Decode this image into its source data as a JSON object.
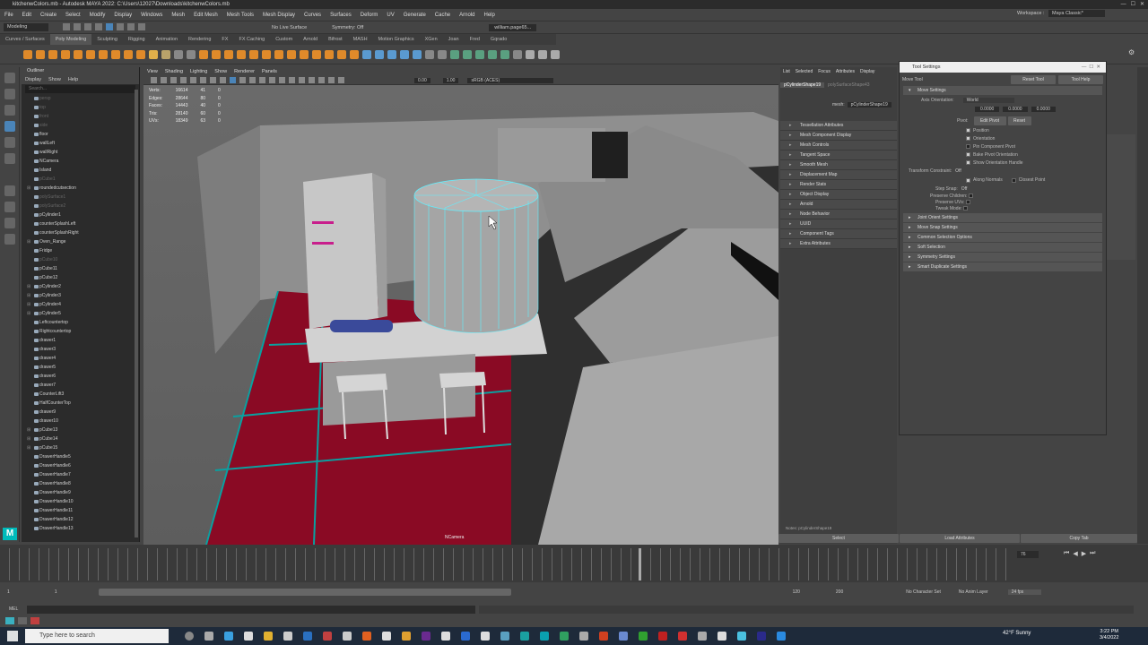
{
  "window": {
    "title": "kitchenwColors.mb - Autodesk MAYA 2022: C:\\Users\\12027\\Downloads\\kitchenwColors.mb"
  },
  "menubar": {
    "items": [
      "File",
      "Edit",
      "Create",
      "Select",
      "Modify",
      "Display",
      "Windows",
      "Mesh",
      "Edit Mesh",
      "Mesh Tools",
      "Mesh Display",
      "Curves",
      "Surfaces",
      "Deform",
      "UV",
      "Generate",
      "Cache",
      "Arnold",
      "Help"
    ],
    "workspace_label": "Workspace :",
    "workspace_value": "Maya Classic*"
  },
  "statusline": {
    "mode": "Modeling",
    "live_surface": "No Live Surface",
    "symmetry": "Symmetry: Off",
    "user": "william.page65..."
  },
  "shelf_tabs": [
    "Curves / Surfaces",
    "Poly Modeling",
    "Sculpting",
    "Rigging",
    "Animation",
    "Rendering",
    "FX",
    "FX Caching",
    "Custom",
    "Arnold",
    "Bifrost",
    "MASH",
    "Motion Graphics",
    "XGen",
    "Joan",
    "Fred",
    "Gqrado"
  ],
  "shelf_active": "Poly Modeling",
  "outliner": {
    "title": "Outliner",
    "menus": [
      "Display",
      "Show",
      "Help"
    ],
    "search_placeholder": "Search...",
    "items": [
      {
        "label": "persp",
        "dim": true
      },
      {
        "label": "top",
        "dim": true
      },
      {
        "label": "front",
        "dim": true
      },
      {
        "label": "side",
        "dim": true
      },
      {
        "label": "floor",
        "dim": false
      },
      {
        "label": "wallLeft",
        "dim": false
      },
      {
        "label": "wallRight",
        "dim": false
      },
      {
        "label": "NCamera",
        "dim": false
      },
      {
        "label": "Island",
        "dim": false
      },
      {
        "label": "pCube1",
        "dim": true
      },
      {
        "label": "roundedcutsection",
        "dim": false,
        "exp": true
      },
      {
        "label": "polySurface1",
        "dim": true
      },
      {
        "label": "polySurface2",
        "dim": true
      },
      {
        "label": "pCylinder1",
        "dim": false
      },
      {
        "label": "counterSplashLeft",
        "dim": false
      },
      {
        "label": "counterSplashRight",
        "dim": false
      },
      {
        "label": "Oven_Range",
        "dim": false,
        "exp": true
      },
      {
        "label": "Fridge",
        "dim": false
      },
      {
        "label": "pCube10",
        "dim": true
      },
      {
        "label": "pCube11",
        "dim": false
      },
      {
        "label": "pCube12",
        "dim": false
      },
      {
        "label": "pCylinder2",
        "dim": false,
        "exp": true
      },
      {
        "label": "pCylinder3",
        "dim": false,
        "exp": true
      },
      {
        "label": "pCylinder4",
        "dim": false,
        "exp": true
      },
      {
        "label": "pCylinder5",
        "dim": false,
        "exp": true
      },
      {
        "label": "Leftcountertop",
        "dim": false
      },
      {
        "label": "Rightcountertop",
        "dim": false
      },
      {
        "label": "drawer1",
        "dim": false
      },
      {
        "label": "drawer3",
        "dim": false
      },
      {
        "label": "drawer4",
        "dim": false
      },
      {
        "label": "drawer5",
        "dim": false
      },
      {
        "label": "drawer6",
        "dim": false
      },
      {
        "label": "drawer7",
        "dim": false
      },
      {
        "label": "CounterLift3",
        "dim": false
      },
      {
        "label": "HalfCounterTop",
        "dim": false
      },
      {
        "label": "drawer9",
        "dim": false
      },
      {
        "label": "drawer10",
        "dim": false
      },
      {
        "label": "pCube13",
        "dim": false,
        "exp": true
      },
      {
        "label": "pCube14",
        "dim": false,
        "exp": true
      },
      {
        "label": "pCube15",
        "dim": false,
        "exp": true
      },
      {
        "label": "DrawerHandle5",
        "dim": false
      },
      {
        "label": "DrawerHandle6",
        "dim": false
      },
      {
        "label": "DrawerHandle7",
        "dim": false
      },
      {
        "label": "DrawerHandle8",
        "dim": false
      },
      {
        "label": "DrawerHandle9",
        "dim": false
      },
      {
        "label": "DrawerHandle10",
        "dim": false
      },
      {
        "label": "DrawerHandle11",
        "dim": false
      },
      {
        "label": "DrawerHandle12",
        "dim": false
      },
      {
        "label": "DrawerHandle13",
        "dim": false
      }
    ]
  },
  "viewport": {
    "menus": [
      "View",
      "Shading",
      "Lighting",
      "Show",
      "Renderer",
      "Panels"
    ],
    "hud": {
      "rows": [
        [
          "Verts:",
          "16614",
          "41",
          "0"
        ],
        [
          "Edges:",
          "28644",
          "80",
          "0"
        ],
        [
          "Faces:",
          "14443",
          "40",
          "0"
        ],
        [
          "Tris:",
          "28140",
          "60",
          "0"
        ],
        [
          "UVs:",
          "18349",
          "63",
          "0"
        ]
      ]
    },
    "camera_label": "NCamera",
    "colorspace": "sRGB (ACES)",
    "exposure": "0.00",
    "gamma": "1.00"
  },
  "channelbox": {
    "tabs": [
      "List",
      "Selected",
      "Focus",
      "Attributes",
      "Display"
    ],
    "node_tab1": "pCylinderShape19",
    "node_tab2": "polySurfaceShape43",
    "mesh_label": "mesh:",
    "mesh_value": "pCylinderShape19",
    "sections": [
      "Tessellation Attributes",
      "Mesh Component Display",
      "Mesh Controls",
      "Tangent Space",
      "Smooth Mesh",
      "Displacement Map",
      "Render Stats",
      "Object Display",
      "Arnold",
      "Node Behavior",
      "UUID",
      "Component Tags",
      "Extra Attributes"
    ],
    "notes": "Notes: pCylinderShape19",
    "select_btn": "Select",
    "load_attr_btn": "Load Attributes",
    "copy_tab_btn": "Copy Tab"
  },
  "tool_settings": {
    "title": "Tool Settings",
    "tool_name": "Move Tool",
    "reset_btn": "Reset Tool",
    "help_btn": "Tool Help",
    "move_settings": "Move Settings",
    "axis_orientation_label": "Axis Orientation:",
    "axis_orientation_value": "World",
    "vals": [
      "0.0000",
      "0.0000",
      "0.0000"
    ],
    "pivot_label": "Pivot:",
    "edit_pivot": "Edit Pivot",
    "reset": "Reset",
    "checks": [
      {
        "label": "Position",
        "on": true
      },
      {
        "label": "Orientation",
        "on": true
      },
      {
        "label": "Pin Component Pivot",
        "on": false
      },
      {
        "label": "Bake Pivot Orientation",
        "on": true
      },
      {
        "label": "Show Orientation Handle",
        "on": true
      }
    ],
    "transform_constraint_label": "Transform Constraint:",
    "transform_constraint_value": "Off",
    "along_normals": "Along Normals",
    "closest_point": "Closest Point",
    "step_snap_label": "Step Snap:",
    "step_snap_value": "Off",
    "preserve_children": "Preserve Children:",
    "preserve_uvs": "Preserve UVs:",
    "tweak_mode": "Tweak Mode:",
    "sections": [
      "Joint Orient Settings",
      "Move Snap Settings",
      "Common Selection Options",
      "Soft Selection",
      "Symmetry Settings",
      "Smart Duplicate Settings"
    ]
  },
  "timeline": {
    "current_frame": "76",
    "start": "1",
    "start2": "1",
    "end": "120",
    "end2": "200",
    "range_end": "120",
    "no_char_set": "No Character Set",
    "no_anim_layer": "No Anim Layer",
    "fps": "24 fps"
  },
  "cmdline": {
    "label": "MEL"
  },
  "taskbar": {
    "search_placeholder": "Type here to search",
    "weather": "42°F Sunny",
    "time": "3:22 PM",
    "date": "3/4/2022"
  }
}
